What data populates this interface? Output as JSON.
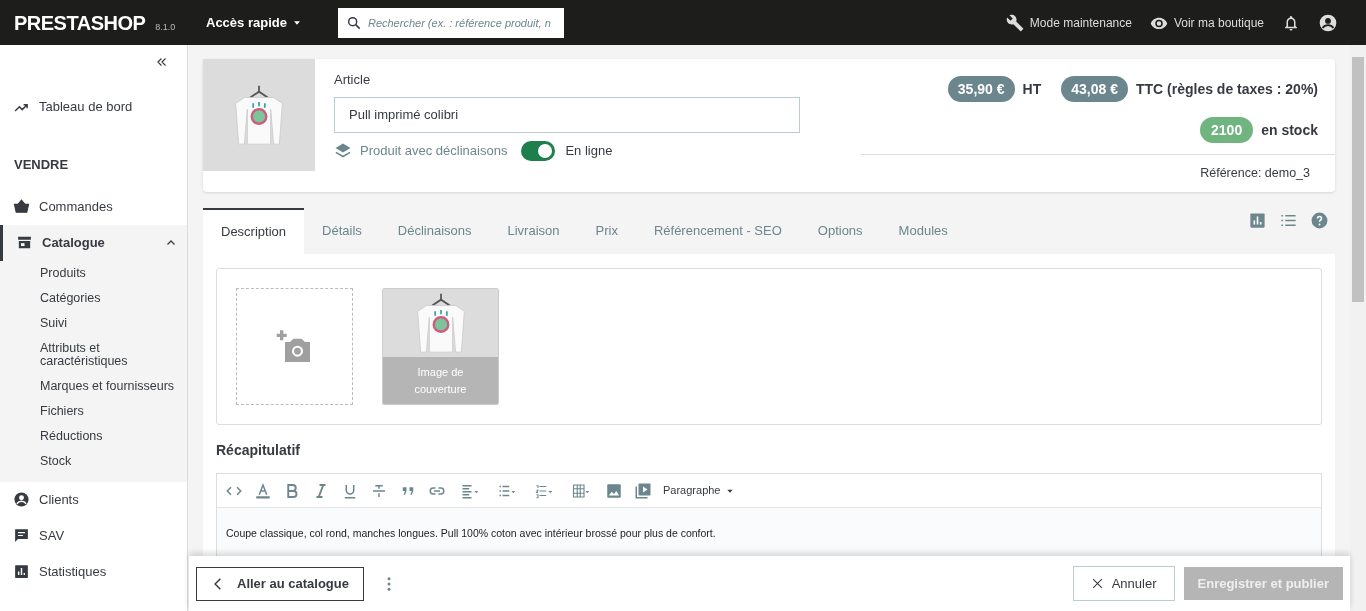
{
  "header": {
    "logo": "PRESTASHOP",
    "version": "8.1.0",
    "quick_access": "Accès rapide",
    "search_placeholder": "Rechercher (ex. : référence produit, n",
    "maintenance": "Mode maintenance",
    "view_shop": "Voir ma boutique"
  },
  "sidebar": {
    "entries": [
      {
        "kind": "link",
        "label": "Tableau de bord",
        "selected": false
      },
      {
        "kind": "heading",
        "label": "VENDRE"
      },
      {
        "kind": "link",
        "label": "Commandes",
        "selected": false
      },
      {
        "kind": "link",
        "label": "Catalogue",
        "selected": true,
        "expanded": true,
        "children": [
          {
            "label": "Produits",
            "selected": false
          },
          {
            "label": "Catégories",
            "selected": false
          },
          {
            "label": "Suivi",
            "selected": false
          },
          {
            "label": "Attributs et caractéristiques",
            "selected": false
          },
          {
            "label": "Marques et fournisseurs",
            "selected": false
          },
          {
            "label": "Fichiers",
            "selected": false
          },
          {
            "label": "Réductions",
            "selected": false
          },
          {
            "label": "Stock",
            "selected": false
          }
        ]
      },
      {
        "kind": "link",
        "label": "Clients",
        "selected": false
      },
      {
        "kind": "link",
        "label": "SAV",
        "selected": false
      },
      {
        "kind": "link",
        "label": "Statistiques",
        "selected": false
      }
    ]
  },
  "product": {
    "name_label": "Article",
    "name": "Pull imprimé colibri",
    "type": "Produit avec déclinaisons",
    "online": true,
    "online_label": "En ligne",
    "price_ht": "35,90 €",
    "ht_label": "HT",
    "price_ttc": "43,08 €",
    "ttc_label": "TTC (règles de taxes : 20%)",
    "stock": "2100",
    "stock_label": "en stock",
    "reference": "Référence: demo_3"
  },
  "tabs": [
    {
      "label": "Description",
      "selected": true
    },
    {
      "label": "Détails",
      "selected": false
    },
    {
      "label": "Déclinaisons",
      "selected": false
    },
    {
      "label": "Livraison",
      "selected": false
    },
    {
      "label": "Prix",
      "selected": false
    },
    {
      "label": "Référencement - SEO",
      "selected": false
    },
    {
      "label": "Options",
      "selected": false
    },
    {
      "label": "Modules",
      "selected": false
    }
  ],
  "images": {
    "cover_caption": "Image de couverture"
  },
  "summary": {
    "title": "Récapitulatif",
    "format": "Paragraphe",
    "text": "Coupe classique, col rond, manches longues. Pull 100% coton avec intérieur brossé pour plus de confort."
  },
  "footer": {
    "back": "Aller au catalogue",
    "cancel": "Annuler",
    "save": "Enregistrer et publier",
    "save_disabled": true
  }
}
